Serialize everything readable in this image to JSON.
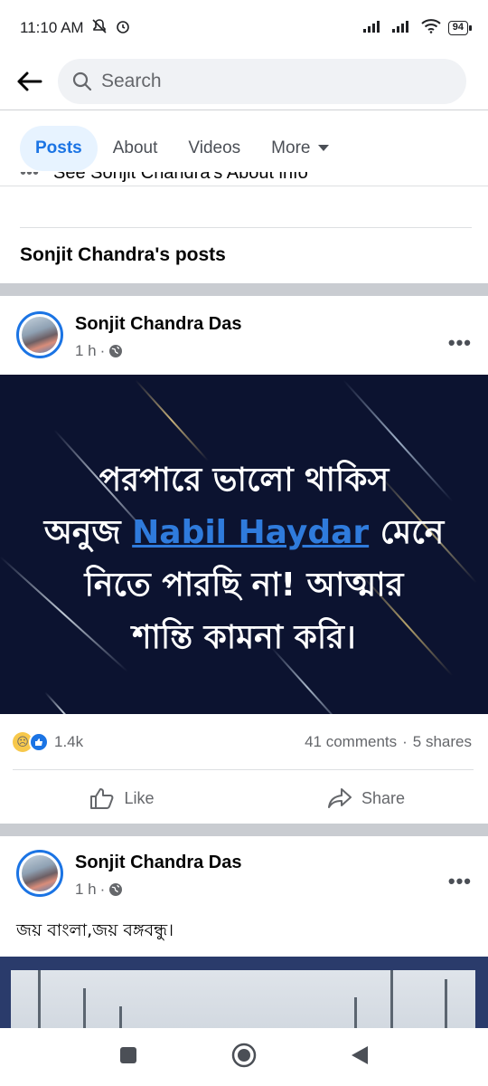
{
  "status_bar": {
    "time": "11:10 AM",
    "battery": "94"
  },
  "search": {
    "placeholder": "Search"
  },
  "tabs": [
    {
      "label": "Posts",
      "active": true
    },
    {
      "label": "About"
    },
    {
      "label": "Videos"
    },
    {
      "label": "More"
    }
  ],
  "about_peek": {
    "text": "See Sonjit Chandra's About info"
  },
  "section": {
    "heading": "Sonjit Chandra's posts"
  },
  "post1": {
    "author": "Sonjit Chandra Das",
    "time": "1 h",
    "image_text": {
      "line1": "পরপারে ভালো থাকিস",
      "line2_pre": "অনুজ",
      "mention": "Nabil Haydar",
      "line2_post": "মেনে",
      "line3": "নিতে পারছি না! আত্মার",
      "line4": "শান্তি কামনা করি।"
    },
    "reactions_count": "1.4k",
    "comments": "41 comments",
    "shares": "5 shares",
    "like_label": "Like",
    "share_label": "Share"
  },
  "post2": {
    "author": "Sonjit Chandra Das",
    "time": "1 h",
    "caption": "জয় বাংলা,জয় বঙ্গবন্ধু।"
  },
  "colors": {
    "accent": "#1b74e4",
    "image_bg": "#0c1330"
  }
}
